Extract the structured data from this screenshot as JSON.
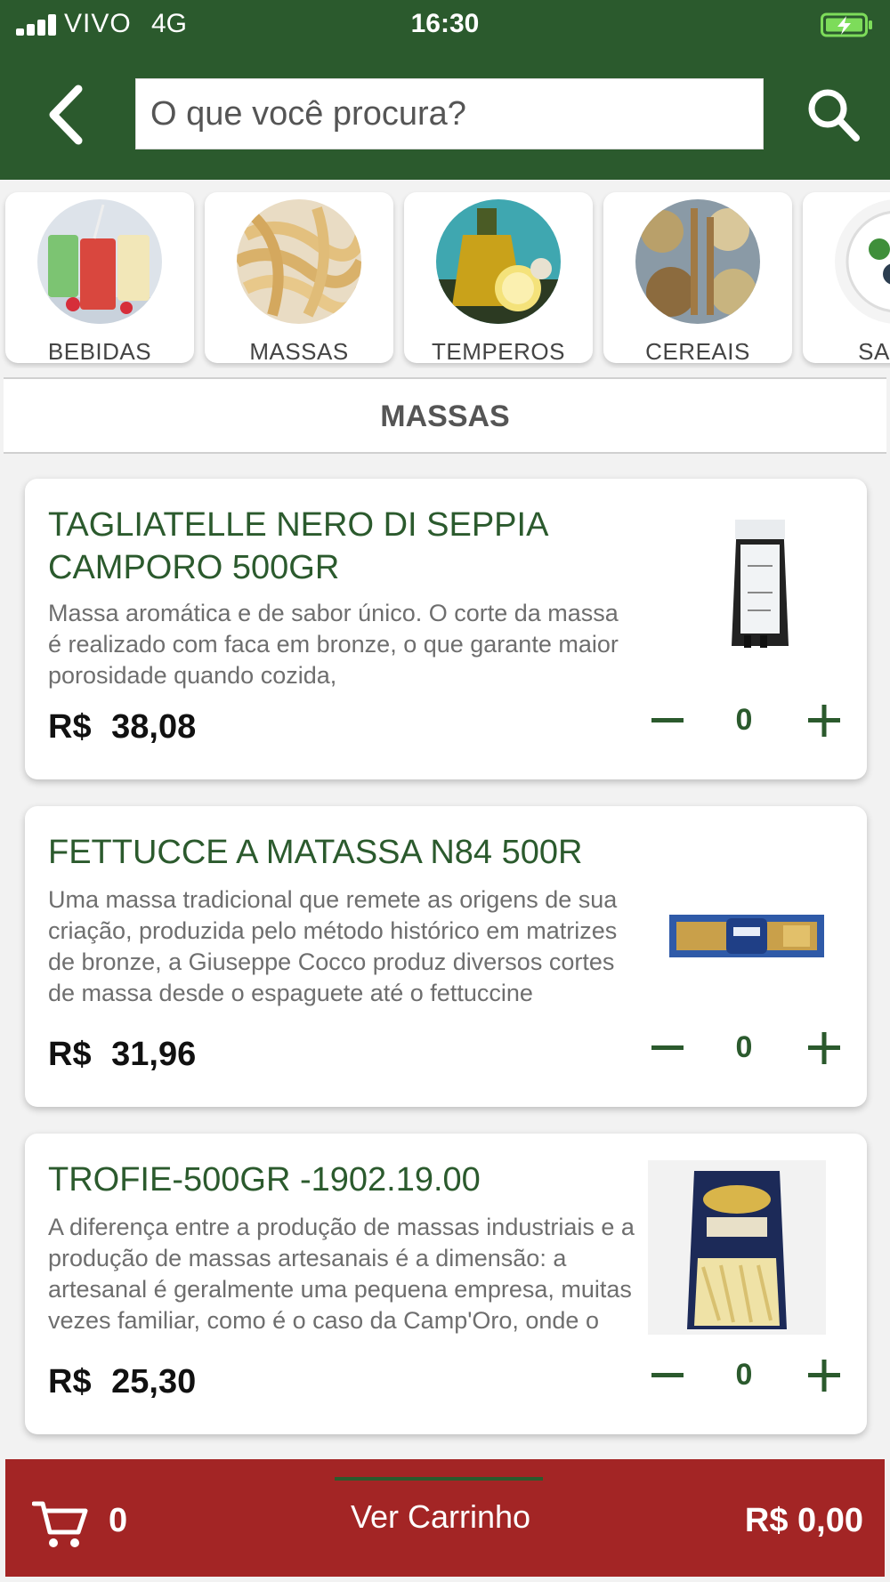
{
  "status_bar": {
    "carrier": "VIVO",
    "network": "4G",
    "time": "16:30"
  },
  "header": {
    "search_placeholder": "O que você procura?"
  },
  "categories": [
    {
      "label": "BEBIDAS"
    },
    {
      "label": "MASSAS"
    },
    {
      "label": "TEMPEROS"
    },
    {
      "label": "CEREAIS"
    },
    {
      "label": "SALAD"
    }
  ],
  "section_title": "MASSAS",
  "products": [
    {
      "name": "TAGLIATELLE NERO DI SEPPIA CAMPORO 500GR",
      "description": "Massa aromática e de sabor único. O corte da massa é realizado com faca em bronze, o que garante maior porosidade quando cozida,",
      "price_label": "R$ 38,08",
      "quantity": "0"
    },
    {
      "name": "FETTUCCE A MATASSA N84 500R",
      "description": "Uma massa tradicional que remete as origens de sua criação, produzida pelo método histórico em matrizes de bronze, a Giuseppe Cocco produz diversos cortes de massa desde o espaguete até o fettuccine",
      "price_label": "R$ 31,96",
      "quantity": "0"
    },
    {
      "name": "TROFIE-500GR -1902.19.00",
      "description": "A diferença entre a produção de massas industriais e a produção de massas artesanais é a dimensão: a artesanal é geralmente uma pequena empresa, muitas vezes familiar, como é o caso da Camp'Oro, onde o empresário também está",
      "price_label": "R$ 25,30",
      "quantity": "0"
    }
  ],
  "cart": {
    "count": "0",
    "button_label": "Ver Carrinho",
    "total": "R$ 0,00"
  },
  "colors": {
    "brand_green": "#2b5a2d",
    "cart_red": "#a32525",
    "background": "#f2f2f2"
  }
}
